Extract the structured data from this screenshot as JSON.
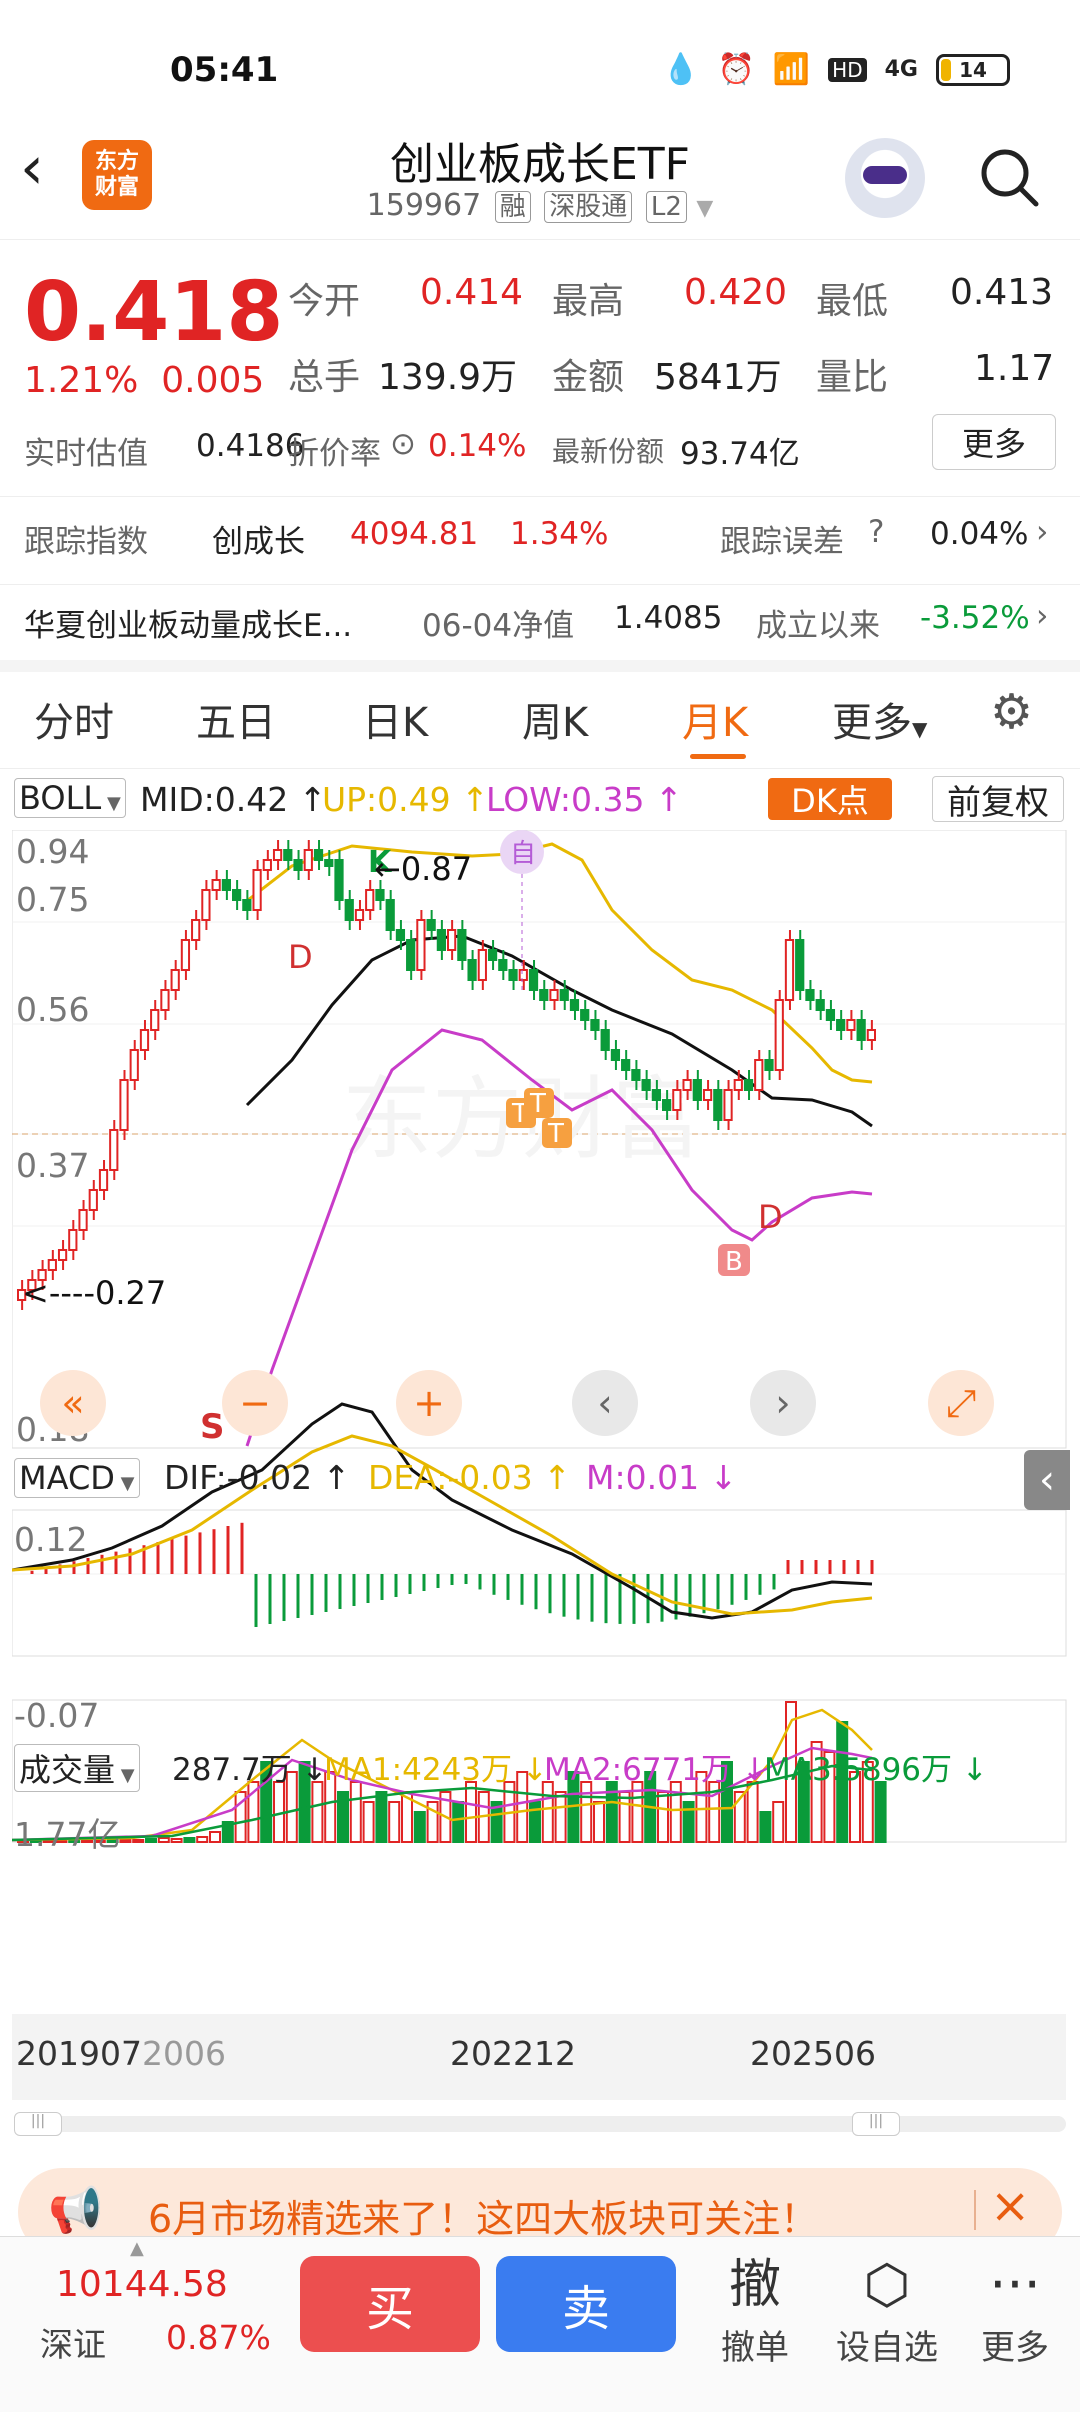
{
  "status_bar": {
    "time": "05:41",
    "battery": "14",
    "signal": "4G",
    "hd": "HD"
  },
  "header": {
    "logo_line1": "东方",
    "logo_line2": "财富",
    "title": "创业板成长ETF",
    "code": "159967",
    "tags": [
      "融",
      "深股通",
      "L2"
    ]
  },
  "quote": {
    "price": "0.418",
    "change_pct": "1.21%",
    "change": "0.005",
    "open_label": "今开",
    "open": "0.414",
    "high_label": "最高",
    "high": "0.420",
    "low_label": "最低",
    "low": "0.413",
    "volume_label": "总手",
    "volume": "139.9万",
    "amount_label": "金额",
    "amount": "5841万",
    "ratio_label": "量比",
    "ratio": "1.17",
    "iopv_label": "实时估值",
    "iopv": "0.4186",
    "premium_label": "折价率",
    "premium": "0.14%",
    "shares_label": "最新份额",
    "shares": "93.74亿",
    "more_label": "更多"
  },
  "tracking": {
    "label": "跟踪指数",
    "index_name": "创成长",
    "index_value": "4094.81",
    "index_pct": "1.34%",
    "error_label": "跟踪误差",
    "error": "0.04%"
  },
  "fund": {
    "name": "华夏创业板动量成长E...",
    "nav_label": "06-04净值",
    "nav": "1.4085",
    "since_label": "成立以来",
    "since": "-3.52%"
  },
  "tabs": [
    "分时",
    "五日",
    "日K",
    "周K",
    "月K",
    "更多"
  ],
  "active_tab": "月K",
  "boll": {
    "label": "BOLL",
    "mid": "MID:0.42",
    "up": "UP:0.49",
    "low": "LOW:0.35",
    "dk_label": "DK点",
    "adjust_label": "前复权",
    "y_labels": [
      "0.94",
      "0.75",
      "0.56",
      "0.37",
      "0.18"
    ],
    "max_note": "0.87",
    "min_note": "<----0.27",
    "markers": {
      "k": "K",
      "d": "D",
      "s": "S",
      "t": "T",
      "b": "B",
      "self": "自"
    }
  },
  "macd": {
    "label": "MACD",
    "dif": "DIF:-0.02",
    "dea": "DEA:-0.03",
    "m": "M:0.01",
    "y_top": "0.12",
    "y_bottom": "-0.07"
  },
  "volume": {
    "label": "成交量",
    "value": "287.7万",
    "ma1": "MA1:4243万",
    "ma2": "MA2:6771万",
    "ma3": "MA3:5896万",
    "y_top": "1.77亿",
    "x_labels": [
      "201907",
      "2006",
      "202212",
      "202506"
    ]
  },
  "banner": {
    "text": "6月市场精选来了！这四大板块可关注！"
  },
  "bottom": {
    "index_value": "10144.58",
    "index_name": "深证",
    "index_pct": "0.87%",
    "buy": "买",
    "sell": "卖",
    "cancel_icon": "撤",
    "cancel": "撤单",
    "watchlist": "设自选",
    "more": "更多"
  },
  "colors": {
    "up": "#e02424",
    "down": "#0a9b3a",
    "accent": "#f06a12",
    "boll_up": "#e6b800",
    "boll_low": "#c83cc8"
  }
}
